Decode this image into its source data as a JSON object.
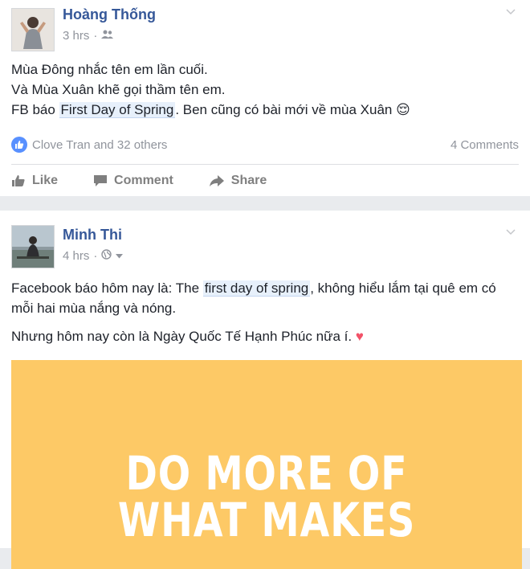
{
  "posts": [
    {
      "author": "Hoàng Thống",
      "time": "3 hrs",
      "privacy_icon": "friends-icon",
      "lines": [
        "Mùa Đông nhắc tên em lần cuối.",
        "Và Mùa Xuân khẽ gọi thầm tên em."
      ],
      "line3_before": "FB báo ",
      "line3_highlight": "First Day of Spring",
      "line3_after": ". Ben cũng có bài mới về mùa Xuân ",
      "emoji": "😌",
      "reactions_text": "Clove Tran and 32 others",
      "comments_text": "4 Comments",
      "actions": {
        "like": "Like",
        "comment": "Comment",
        "share": "Share"
      }
    },
    {
      "author": "Minh Thi",
      "time": "4 hrs",
      "privacy_icon": "globe-icon",
      "p1_before": "Facebook báo hôm nay là: The ",
      "p1_highlight": "first day of spring",
      "p1_after": ", không hiểu lắm tại quê em có mỗi hai mùa nắng và nóng.",
      "p2": "Nhưng hôm nay còn là Ngày Quốc Tế Hạnh Phúc nữa í. ",
      "emoji": "♥",
      "poster_lines": [
        "DO MORE OF",
        "WHAT MAKES"
      ],
      "poster_color": "#fdc966"
    }
  ],
  "colors": {
    "name": "#365899",
    "meta": "#90949c",
    "like_blue": "#5890ff",
    "background": "#e9ebee"
  }
}
